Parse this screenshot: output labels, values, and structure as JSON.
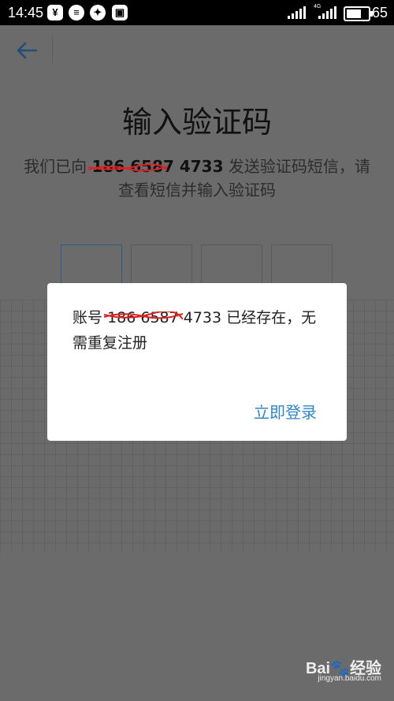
{
  "status_bar": {
    "time": "14:45",
    "notification_icons": [
      "yen-icon",
      "chat-icon",
      "sync-icon",
      "image-icon"
    ],
    "network_label": "4G",
    "battery": "65"
  },
  "header": {
    "back_icon": "arrow-left-icon"
  },
  "page": {
    "title": "输入验证码",
    "subtitle_prefix": "我们已向",
    "phone_masked": "186 6587 4733",
    "subtitle_suffix": "发送验证码短信，请查看短信并输入验证码",
    "code_boxes": 4
  },
  "dialog": {
    "message_prefix": "账号",
    "account_masked": "186 6587 4733",
    "message_suffix": "已经存在，无需重复注册",
    "action_label": "立即登录",
    "accent_color": "#2f86c9"
  },
  "watermark": {
    "logo": "Bai🐾经验",
    "site": "jingyan.baidu.com"
  }
}
